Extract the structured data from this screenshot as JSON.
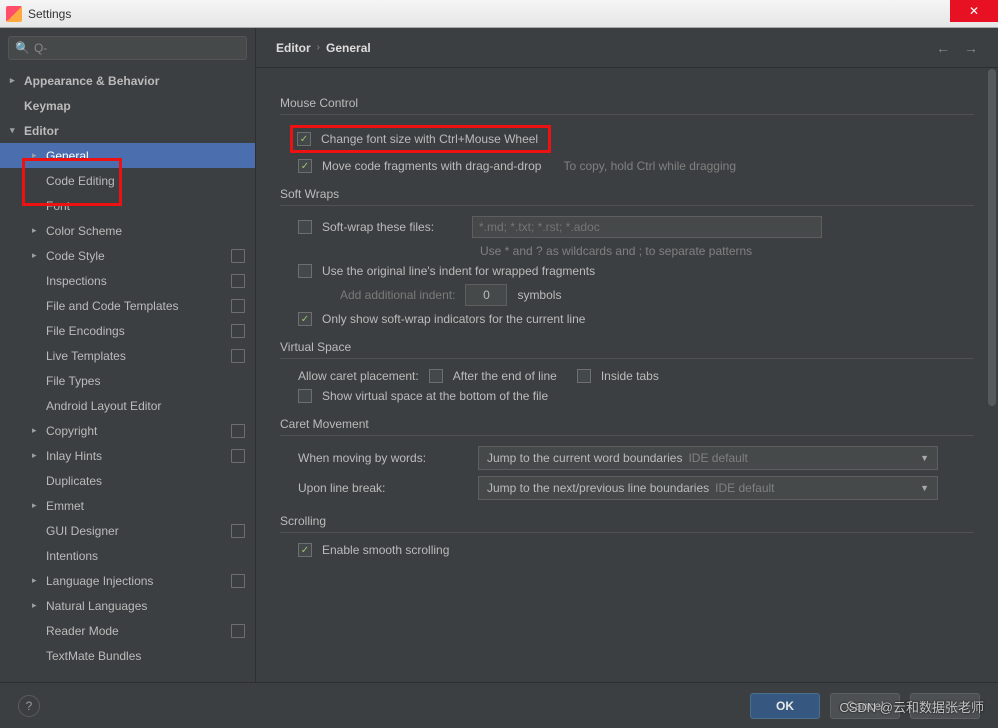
{
  "window": {
    "title": "Settings"
  },
  "search_placeholder": "Q-",
  "breadcrumb": {
    "root": "Editor",
    "leaf": "General"
  },
  "sidebar": [
    {
      "label": "Appearance & Behavior",
      "level": 0,
      "expandable": true,
      "bold": true
    },
    {
      "label": "Keymap",
      "level": 0,
      "bold": true
    },
    {
      "label": "Editor",
      "level": 0,
      "expandable": true,
      "expanded": true,
      "bold": true
    },
    {
      "label": "General",
      "level": 1,
      "expandable": true,
      "selected": true
    },
    {
      "label": "Code Editing",
      "level": 1
    },
    {
      "label": "Font",
      "level": 1
    },
    {
      "label": "Color Scheme",
      "level": 1,
      "expandable": true
    },
    {
      "label": "Code Style",
      "level": 1,
      "expandable": true,
      "badge": true
    },
    {
      "label": "Inspections",
      "level": 1,
      "badge": true
    },
    {
      "label": "File and Code Templates",
      "level": 1,
      "badge": true
    },
    {
      "label": "File Encodings",
      "level": 1,
      "badge": true
    },
    {
      "label": "Live Templates",
      "level": 1,
      "badge": true
    },
    {
      "label": "File Types",
      "level": 1
    },
    {
      "label": "Android Layout Editor",
      "level": 1
    },
    {
      "label": "Copyright",
      "level": 1,
      "expandable": true,
      "badge": true
    },
    {
      "label": "Inlay Hints",
      "level": 1,
      "expandable": true,
      "badge": true
    },
    {
      "label": "Duplicates",
      "level": 1
    },
    {
      "label": "Emmet",
      "level": 1,
      "expandable": true
    },
    {
      "label": "GUI Designer",
      "level": 1,
      "badge": true
    },
    {
      "label": "Intentions",
      "level": 1
    },
    {
      "label": "Language Injections",
      "level": 1,
      "expandable": true,
      "badge": true
    },
    {
      "label": "Natural Languages",
      "level": 1,
      "expandable": true
    },
    {
      "label": "Reader Mode",
      "level": 1,
      "badge": true
    },
    {
      "label": "TextMate Bundles",
      "level": 1
    }
  ],
  "sections": {
    "mouse": {
      "title": "Mouse Control",
      "change_font": "Change font size with Ctrl+Mouse Wheel",
      "move_frag": "Move code fragments with drag-and-drop",
      "move_hint": "To copy, hold Ctrl while dragging"
    },
    "softwraps": {
      "title": "Soft Wraps",
      "wrap_files": "Soft-wrap these files:",
      "wrap_placeholder": "*.md; *.txt; *.rst; *.adoc",
      "wildcard_hint": "Use * and ? as wildcards and ; to separate patterns",
      "orig_indent": "Use the original line's indent for wrapped fragments",
      "add_indent_label": "Add additional indent:",
      "add_indent_value": "0",
      "symbols": "symbols",
      "only_current": "Only show soft-wrap indicators for the current line"
    },
    "virtual": {
      "title": "Virtual Space",
      "allow_caret": "Allow caret placement:",
      "after_eol": "After the end of line",
      "inside_tabs": "Inside tabs",
      "show_vs": "Show virtual space at the bottom of the file"
    },
    "caret": {
      "title": "Caret Movement",
      "by_words": "When moving by words:",
      "by_words_val": "Jump to the current word boundaries",
      "line_break": "Upon line break:",
      "line_break_val": "Jump to the next/previous line boundaries",
      "ide_default": "IDE default"
    },
    "scrolling": {
      "title": "Scrolling",
      "smooth": "Enable smooth scrolling"
    }
  },
  "buttons": {
    "ok": "OK",
    "cancel": "Cancel",
    "apply": "Apply"
  },
  "watermark": "CSDN @云和数据张老师"
}
